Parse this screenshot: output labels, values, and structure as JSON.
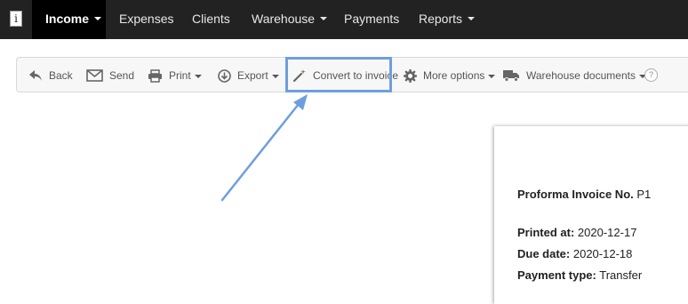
{
  "nav": {
    "logo": "i",
    "items": [
      {
        "label": "Income",
        "active": true,
        "dropdown": true
      },
      {
        "label": "Expenses",
        "active": false,
        "dropdown": false
      },
      {
        "label": "Clients",
        "active": false,
        "dropdown": false
      },
      {
        "label": "Warehouse",
        "active": false,
        "dropdown": true
      },
      {
        "label": "Payments",
        "active": false,
        "dropdown": false
      },
      {
        "label": "Reports",
        "active": false,
        "dropdown": true
      }
    ]
  },
  "toolbar": {
    "back": "Back",
    "send": "Send",
    "print": "Print",
    "export": "Export",
    "convert": "Convert to invoice",
    "more": "More options",
    "warehouse_docs": "Warehouse documents",
    "help": "?"
  },
  "document": {
    "title_label": "Proforma Invoice No.",
    "title_value": "P1",
    "printed_label": "Printed at:",
    "printed_value": "2020-12-17",
    "due_label": "Due date:",
    "due_value": "2020-12-18",
    "payment_label": "Payment type:",
    "payment_value": "Transfer"
  },
  "colors": {
    "nav_bg": "#222222",
    "nav_active_bg": "#000000",
    "highlight": "#6f9ede",
    "toolbar_bg": "#f7f7f7"
  }
}
